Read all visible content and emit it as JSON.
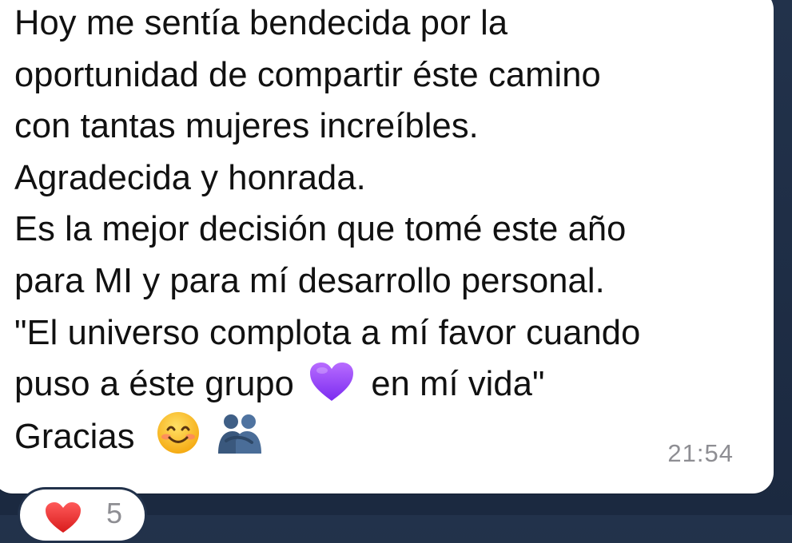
{
  "message": {
    "lines": {
      "l1": "Hoy me sentía bendecida por la",
      "l2": "oportunidad de compartir éste camino",
      "l3": "con tantas mujeres increíbles.",
      "l4": "Agradecida y honrada.",
      "l5": "Es la mejor decisión que tomé este año",
      "l6": "para MI y para mí desarrollo personal.",
      "l7": "\"El universo complota a mí favor cuando",
      "l8a": "puso a éste grupo",
      "l8b": "en mí vida\"",
      "l9": "Gracias"
    },
    "emojis": {
      "purple_heart": "purple-heart-icon",
      "smile": "smiling-face-icon",
      "hug": "people-hugging-icon"
    },
    "time": "21:54"
  },
  "reaction": {
    "icon": "red-heart-icon",
    "count": "5"
  },
  "colors": {
    "background": "#1f2d44",
    "bubble": "#ffffff",
    "text": "#111111",
    "timestamp": "#8e8e93"
  }
}
